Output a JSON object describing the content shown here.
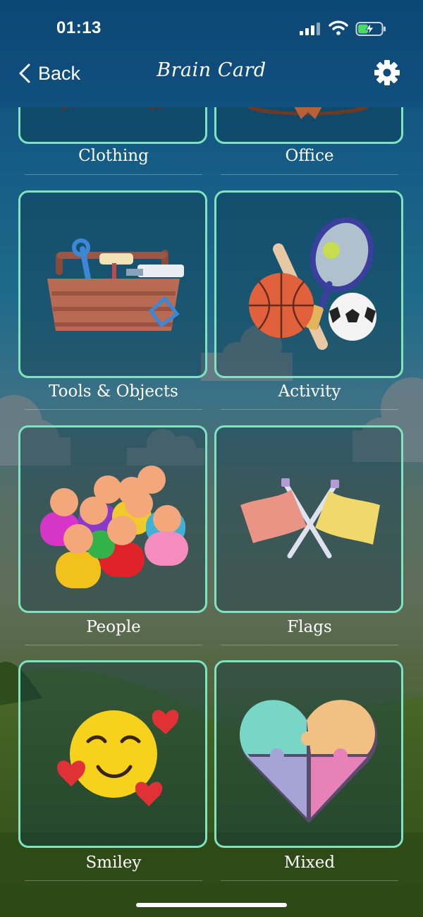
{
  "status_bar": {
    "time": "01:13"
  },
  "nav": {
    "back_label": "Back",
    "title": "Brain Card"
  },
  "categories": [
    {
      "label": "Clothing",
      "icon": "clothing-illustration"
    },
    {
      "label": "Office",
      "icon": "office-illustration"
    },
    {
      "label": "Tools & Objects",
      "icon": "toolbox-illustration"
    },
    {
      "label": "Activity",
      "icon": "sports-balls-illustration"
    },
    {
      "label": "People",
      "icon": "people-group-illustration"
    },
    {
      "label": "Flags",
      "icon": "crossed-flags-illustration"
    },
    {
      "label": "Smiley",
      "icon": "smiley-hearts-illustration"
    },
    {
      "label": "Mixed",
      "icon": "puzzle-heart-illustration"
    }
  ],
  "colors": {
    "card_border": "#7fe3bf",
    "header_bg": "#0c4876"
  }
}
